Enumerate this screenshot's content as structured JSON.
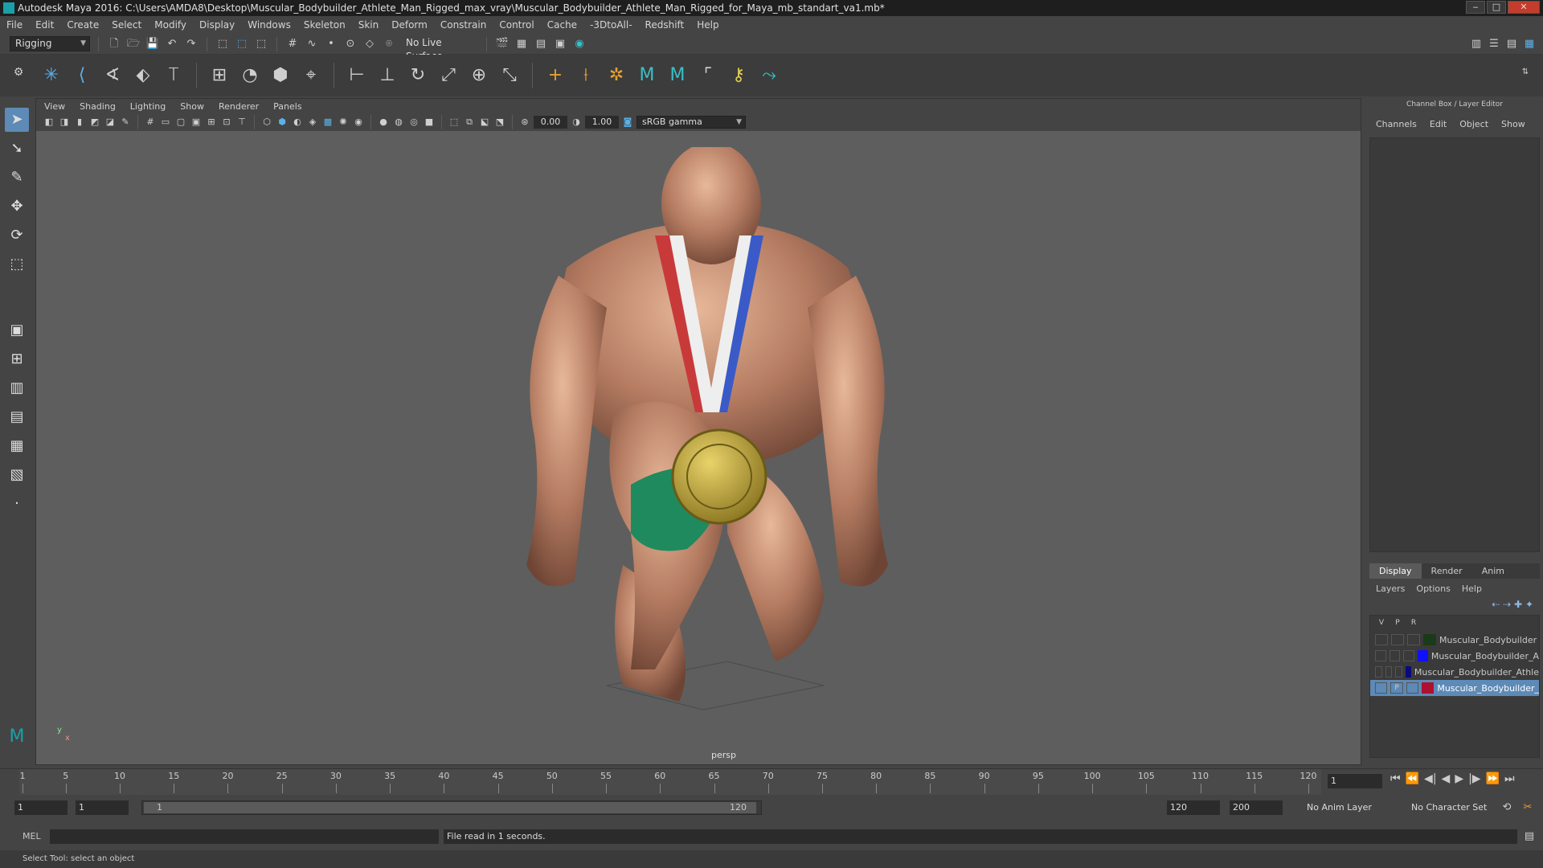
{
  "window": {
    "title": "Autodesk Maya 2016: C:\\Users\\AMDA8\\Desktop\\Muscular_Bodybuilder_Athlete_Man_Rigged_max_vray\\Muscular_Bodybuilder_Athlete_Man_Rigged_for_Maya_mb_standart_va1.mb*",
    "minimize": "‒",
    "maximize": "□",
    "close": "✕"
  },
  "menubar": [
    "File",
    "Edit",
    "Create",
    "Select",
    "Modify",
    "Display",
    "Windows",
    "Skeleton",
    "Skin",
    "Deform",
    "Constrain",
    "Control",
    "Cache",
    "-3DtoAll-",
    "Redshift",
    "Help"
  ],
  "statusline": {
    "menuset": "Rigging",
    "live_surface": "No Live Surface"
  },
  "viewport": {
    "menus": [
      "View",
      "Shading",
      "Lighting",
      "Show",
      "Renderer",
      "Panels"
    ],
    "exposure": "0.00",
    "gamma": "1.00",
    "colorspace": "sRGB gamma",
    "camera": "persp",
    "axis_y": "y",
    "axis_x": "x"
  },
  "channel_box": {
    "title": "Channel Box / Layer Editor",
    "menus": [
      "Channels",
      "Edit",
      "Object",
      "Show"
    ],
    "layer_tabs": [
      "Display",
      "Render",
      "Anim"
    ],
    "layer_menus": [
      "Layers",
      "Options",
      "Help"
    ],
    "layer_headers": {
      "v": "V",
      "p": "P",
      "r": "R"
    },
    "layers": [
      {
        "name": "Muscular_Bodybuilder",
        "color": "#1a3a1a",
        "v": "",
        "p": "",
        "r": ""
      },
      {
        "name": "Muscular_Bodybuilder_A",
        "color": "#1010ff",
        "v": "",
        "p": "",
        "r": ""
      },
      {
        "name": "Muscular_Bodybuilder_Athle",
        "color": "#0a0a80",
        "v": "",
        "p": "",
        "r": ""
      },
      {
        "name": "Muscular_Bodybuilder_",
        "color": "#b01030",
        "v": "",
        "p": "P",
        "r": ""
      }
    ]
  },
  "timeline": {
    "ticks": [
      "1",
      "5",
      "10",
      "15",
      "20",
      "25",
      "30",
      "35",
      "40",
      "45",
      "50",
      "55",
      "60",
      "65",
      "70",
      "75",
      "80",
      "85",
      "90",
      "95",
      "100",
      "105",
      "110",
      "115",
      "120"
    ],
    "current_frame": "1"
  },
  "range": {
    "start": "1",
    "playback_start": "1",
    "slider_start": "1",
    "slider_end": "120",
    "playback_end": "120",
    "end": "200",
    "anim_layer": "No Anim Layer",
    "character_set": "No Character Set"
  },
  "command": {
    "language": "MEL",
    "result": "File read in  1 seconds."
  },
  "help_line": "Select Tool: select an object"
}
